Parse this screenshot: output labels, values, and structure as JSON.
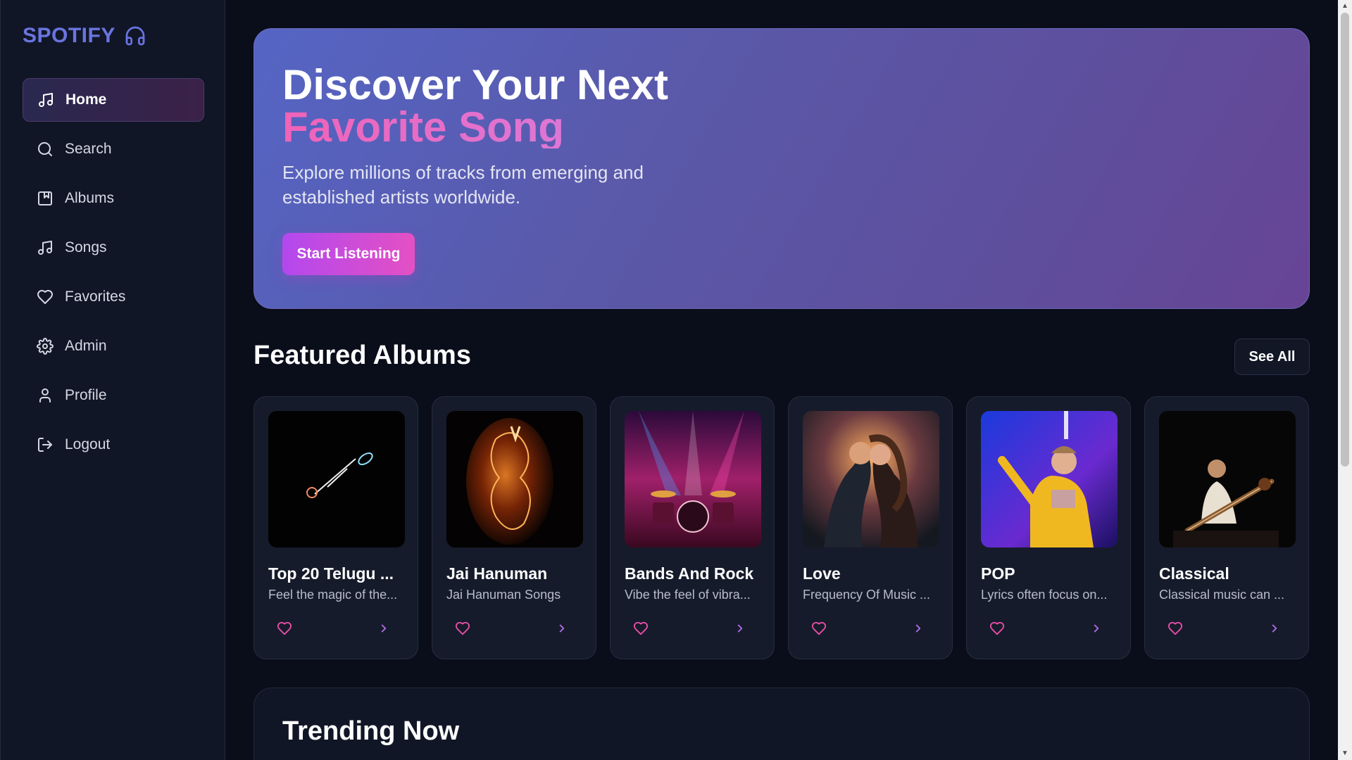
{
  "brand": {
    "name": "SPOTIFY",
    "icon": "headphones-icon",
    "color": "#6a75e0"
  },
  "sidebar": {
    "items": [
      {
        "label": "Home",
        "icon": "music-note-icon",
        "active": true
      },
      {
        "label": "Search",
        "icon": "search-icon",
        "active": false
      },
      {
        "label": "Albums",
        "icon": "album-icon",
        "active": false
      },
      {
        "label": "Songs",
        "icon": "music-note-icon",
        "active": false
      },
      {
        "label": "Favorites",
        "icon": "heart-icon",
        "active": false
      },
      {
        "label": "Admin",
        "icon": "gear-icon",
        "active": false
      },
      {
        "label": "Profile",
        "icon": "user-icon",
        "active": false
      },
      {
        "label": "Logout",
        "icon": "logout-icon",
        "active": false
      }
    ]
  },
  "hero": {
    "title_line1": "Discover Your Next",
    "title_line2": "Favorite Song",
    "subtitle": "Explore millions of tracks from emerging and established artists worldwide.",
    "cta_label": "Start Listening"
  },
  "featured": {
    "title": "Featured Albums",
    "see_all_label": "See All",
    "albums": [
      {
        "title": "Top 20 Telugu ...",
        "description": "Feel the magic of the..."
      },
      {
        "title": "Jai Hanuman",
        "description": "Jai Hanuman Songs"
      },
      {
        "title": "Bands And Rock",
        "description": "Vibe the feel of vibra..."
      },
      {
        "title": "Love",
        "description": "Frequency Of Music ..."
      },
      {
        "title": "POP",
        "description": "Lyrics often focus on..."
      },
      {
        "title": "Classical",
        "description": "Classical music can ..."
      }
    ]
  },
  "trending": {
    "title": "Trending Now"
  },
  "colors": {
    "background": "#0a0d1a",
    "sidebar": "#111627",
    "accent_pink": "#f063b8",
    "accent_purple": "#b348ee"
  }
}
